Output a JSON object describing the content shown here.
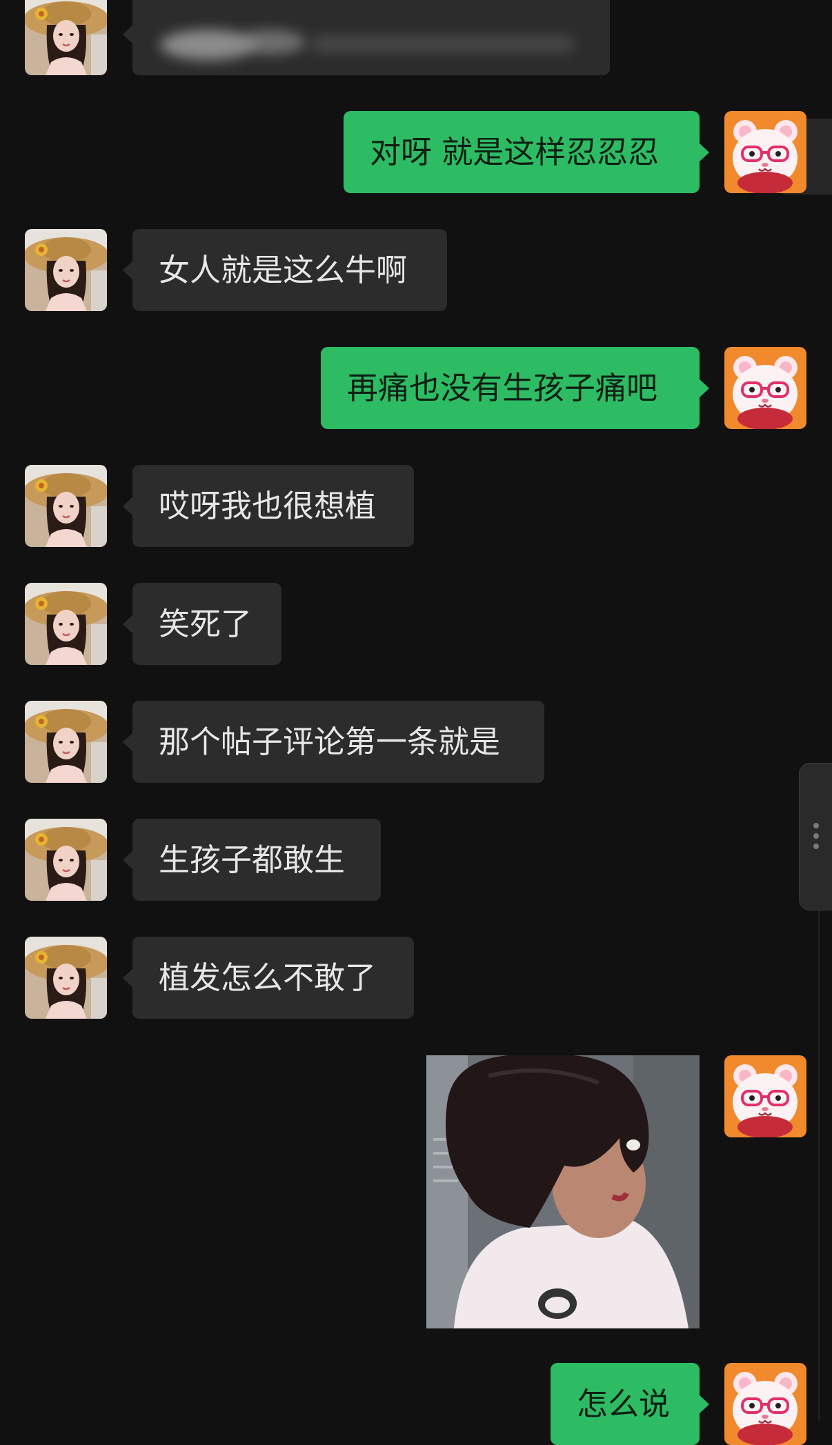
{
  "chat": {
    "messages": [
      {
        "side": "in",
        "text": ""
      },
      {
        "side": "out",
        "text": "对呀 就是这样忍忍忍"
      },
      {
        "side": "in",
        "text": "女人就是这么牛啊"
      },
      {
        "side": "out",
        "text": "再痛也没有生孩子痛吧"
      },
      {
        "side": "in",
        "text": "哎呀我也很想植"
      },
      {
        "side": "in",
        "text": "笑死了"
      },
      {
        "side": "in",
        "text": "那个帖子评论第一条就是"
      },
      {
        "side": "in",
        "text": "生孩子都敢生"
      },
      {
        "side": "in",
        "text": "植发怎么不敢了"
      },
      {
        "side": "out",
        "type": "image"
      },
      {
        "side": "out",
        "text": "怎么说"
      }
    ]
  },
  "colors": {
    "background": "#111111",
    "incoming_bubble": "#2c2c2c",
    "outgoing_bubble": "#2dbc64",
    "incoming_text": "#e7e7e7",
    "outgoing_text": "#0f1f14"
  },
  "icons": {
    "contact_avatar": "woman-straw-hat-avatar",
    "self_avatar": "pink-hamster-glasses-avatar"
  }
}
